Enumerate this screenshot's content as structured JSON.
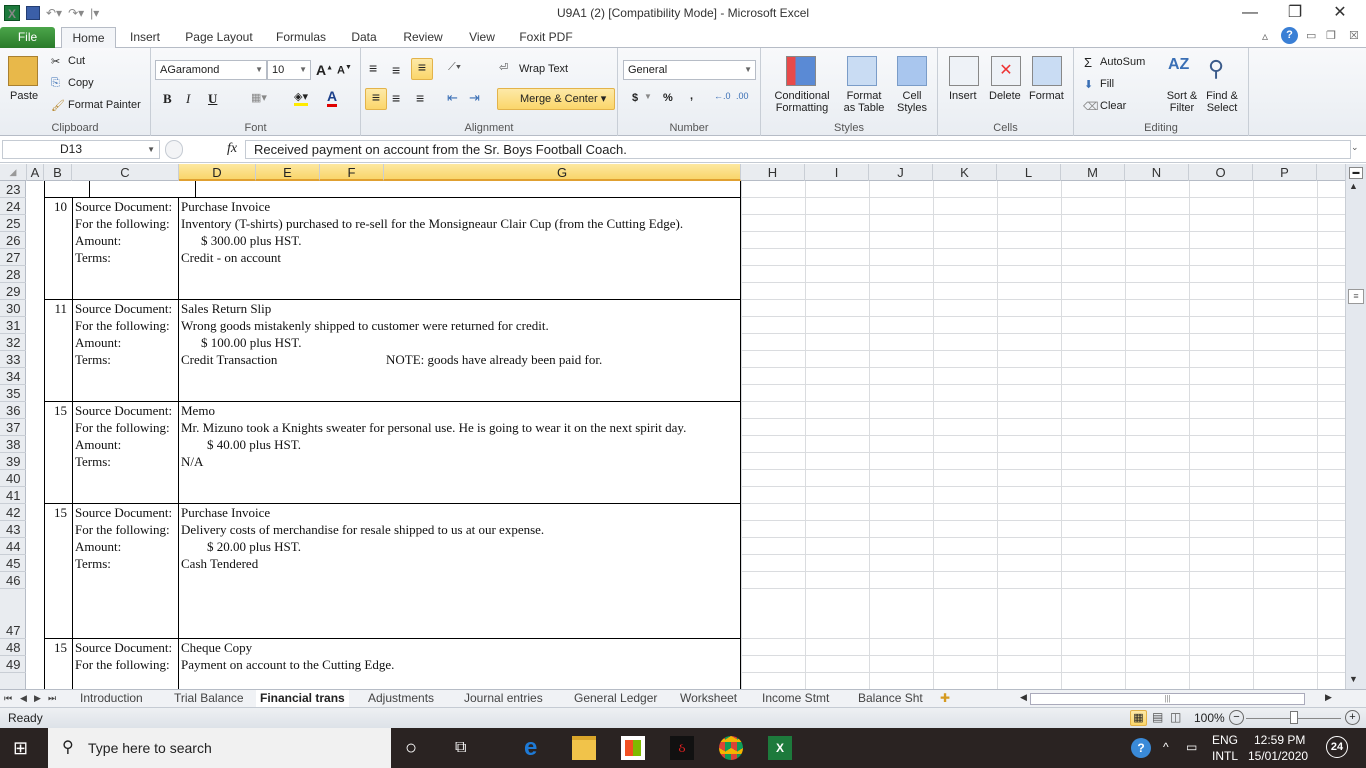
{
  "window": {
    "title": "U9A1 (2)  [Compatibility Mode]  -  Microsoft Excel",
    "minimize": "—",
    "restore": "❐",
    "close": "✕"
  },
  "ribbon_tabs": [
    "File",
    "Home",
    "Insert",
    "Page Layout",
    "Formulas",
    "Data",
    "Review",
    "View",
    "Foxit PDF"
  ],
  "active_tab": "Home",
  "ribbon": {
    "clipboard": {
      "label": "Clipboard",
      "paste": "Paste",
      "cut": "Cut",
      "copy": "Copy",
      "format_painter": "Format Painter"
    },
    "font": {
      "label": "Font",
      "name": "AGaramond",
      "size": "10",
      "bold": "B",
      "italic": "I",
      "underline": "U"
    },
    "alignment": {
      "label": "Alignment",
      "wrap_text": "Wrap Text",
      "merge_center": "Merge & Center"
    },
    "number": {
      "label": "Number",
      "format": "General",
      "currency": "$",
      "percent": "%",
      "comma": ","
    },
    "styles": {
      "label": "Styles",
      "conditional_1": "Conditional",
      "conditional_2": "Formatting",
      "format_table_1": "Format",
      "format_table_2": "as Table",
      "cell_styles_1": "Cell",
      "cell_styles_2": "Styles"
    },
    "cells": {
      "label": "Cells",
      "insert": "Insert",
      "delete": "Delete",
      "format": "Format"
    },
    "editing": {
      "label": "Editing",
      "autosum": "AutoSum",
      "fill": "Fill",
      "clear": "Clear",
      "sort_1": "Sort &",
      "sort_2": "Filter",
      "find_1": "Find &",
      "find_2": "Select"
    }
  },
  "formula_bar": {
    "name_box": "D13",
    "fx": "fx",
    "content": "Received payment on account from the Sr. Boys Football Coach."
  },
  "columns": [
    "A",
    "B",
    "C",
    "D",
    "E",
    "F",
    "G",
    "H",
    "I",
    "J",
    "K",
    "L",
    "M",
    "N",
    "O",
    "P"
  ],
  "rows": [
    "23",
    "24",
    "25",
    "26",
    "27",
    "28",
    "29",
    "30",
    "31",
    "32",
    "33",
    "34",
    "35",
    "36",
    "37",
    "38",
    "39",
    "40",
    "41",
    "42",
    "43",
    "44",
    "45",
    "46",
    "47",
    "48",
    "49"
  ],
  "transactions": [
    {
      "date": "10",
      "source_label": "Source Document:",
      "source": "Purchase Invoice",
      "for_label": "For the following:",
      "description": "Inventory (T-shirts) purchased to re-sell for the Monsigneaur Clair Cup (from the Cutting Edge).",
      "amount_label": "Amount:",
      "amount": "$  300.00   plus HST.",
      "terms_label": "Terms:",
      "terms": "Credit - on account",
      "note": ""
    },
    {
      "date": "11",
      "source_label": "Source Document:",
      "source": "Sales Return Slip",
      "for_label": "For the following:",
      "description": "Wrong goods mistakenly shipped to customer were returned for credit.",
      "amount_label": "Amount:",
      "amount": "$  100.00  plus HST.",
      "terms_label": "Terms:",
      "terms": "Credit Transaction",
      "note": "NOTE: goods have already been paid for."
    },
    {
      "date": "15",
      "source_label": "Source Document:",
      "source": "Memo",
      "for_label": "For the following:",
      "description": "Mr. Mizuno took a Knights sweater for personal use.  He is going to wear it on the next spirit day.",
      "amount_label": "Amount:",
      "amount": "$  40.00  plus HST.",
      "terms_label": "Terms:",
      "terms": "N/A",
      "note": ""
    },
    {
      "date": "15",
      "source_label": "Source Document:",
      "source": "Purchase Invoice",
      "for_label": "For the following:",
      "description": "Delivery costs of merchandise for resale shipped to us at our expense.",
      "amount_label": "Amount:",
      "amount": "$  20.00  plus HST.",
      "terms_label": "Terms:",
      "terms": "Cash Tendered",
      "note": ""
    },
    {
      "date": "15",
      "source_label": "Source Document:",
      "source": "Cheque Copy",
      "for_label": "For the following:",
      "description": "Payment on account to the Cutting Edge."
    }
  ],
  "sheet_tabs": [
    "Introduction",
    "Trial Balance",
    "Financial trans",
    "Adjustments",
    "Journal  entries",
    "General Ledger",
    "Worksheet",
    "Income Stmt",
    "Balance Sht"
  ],
  "active_sheet": "Financial trans",
  "status": {
    "mode": "Ready",
    "zoom": "100%"
  },
  "taskbar": {
    "search_placeholder": "Type here to search",
    "lang_1": "ENG",
    "lang_2": "INTL",
    "time": "12:59 PM",
    "date": "15/01/2020",
    "notifications": "24"
  }
}
